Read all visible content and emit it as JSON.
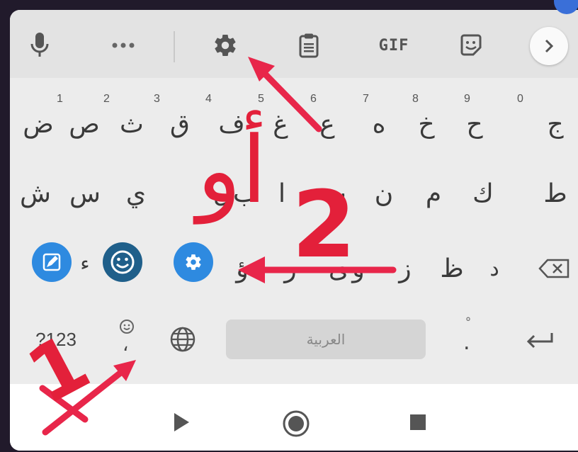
{
  "toolbar": {
    "items": [
      {
        "name": "mic-icon"
      },
      {
        "name": "more-icon"
      },
      {
        "name": "settings-icon"
      },
      {
        "name": "clipboard-icon"
      },
      {
        "name": "gif-button",
        "label": "GIF"
      },
      {
        "name": "sticker-icon"
      },
      {
        "name": "chevron-right-icon"
      }
    ]
  },
  "keyboard": {
    "row1": {
      "keys": [
        "ض",
        "ص",
        "ث",
        "ق",
        "ف",
        "غ",
        "ع",
        "ه",
        "خ",
        "ح",
        "ج"
      ],
      "numbers": [
        "1",
        "2",
        "3",
        "4",
        "5",
        "6",
        "7",
        "8",
        "9",
        "0"
      ]
    },
    "row2": {
      "keys": [
        "ش",
        "س",
        "ي",
        "ب",
        "ل",
        "ا",
        "ت",
        "ن",
        "م",
        "ك",
        "ط"
      ]
    },
    "row3": {
      "keys": [
        "ء",
        "ؤ",
        "ر",
        "ى",
        "ة",
        "و",
        "ز",
        "ظ",
        "د"
      ]
    },
    "row4": {
      "symbols_label": "?123",
      "comma": "،",
      "space_label": "العربية",
      "period": ".",
      "period_hint": "ْ"
    },
    "colors": {
      "accent_blue": "#2e8ae0",
      "dark_blue": "#1f5f8a"
    }
  },
  "annotations": {
    "label_1": "1",
    "label_2": "2",
    "label_or": "أو",
    "color": "#e3203a"
  }
}
